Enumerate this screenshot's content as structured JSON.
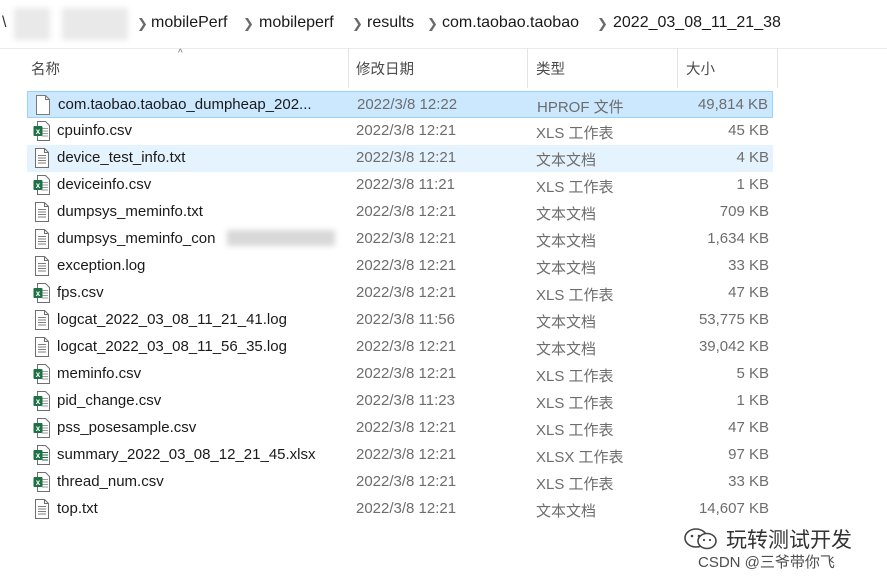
{
  "breadcrumb": [
    "mobilePerf",
    "mobileperf",
    "results",
    "com.taobao.taobao",
    "2022_03_08_11_21_38"
  ],
  "breadcrumb_lead_char": "\\",
  "columns": {
    "name": "名称",
    "date": "修改日期",
    "type": "类型",
    "size": "大小"
  },
  "files": [
    {
      "name": "com.taobao.taobao_dumpheap_202...",
      "date": "2022/3/8 12:22",
      "type": "HPROF 文件",
      "size": "49,814 KB",
      "icon": "blank-file-icon",
      "state": "selected"
    },
    {
      "name": "cpuinfo.csv",
      "date": "2022/3/8 12:21",
      "type": "XLS 工作表",
      "size": "45 KB",
      "icon": "csv-file-icon"
    },
    {
      "name": "device_test_info.txt",
      "date": "2022/3/8 12:21",
      "type": "文本文档",
      "size": "4 KB",
      "icon": "text-file-icon",
      "state": "hover"
    },
    {
      "name": "deviceinfo.csv",
      "date": "2022/3/8 11:21",
      "type": "XLS 工作表",
      "size": "1 KB",
      "icon": "csv-file-icon"
    },
    {
      "name": "dumpsys_meminfo.txt",
      "date": "2022/3/8 12:21",
      "type": "文本文档",
      "size": "709 KB",
      "icon": "text-file-icon"
    },
    {
      "name": "dumpsys_meminfo_con",
      "date": "2022/3/8 12:21",
      "type": "文本文档",
      "size": "1,634 KB",
      "icon": "text-file-icon",
      "blurred": true
    },
    {
      "name": "exception.log",
      "date": "2022/3/8 12:21",
      "type": "文本文档",
      "size": "33 KB",
      "icon": "text-file-icon"
    },
    {
      "name": "fps.csv",
      "date": "2022/3/8 12:21",
      "type": "XLS 工作表",
      "size": "47 KB",
      "icon": "csv-file-icon"
    },
    {
      "name": "logcat_2022_03_08_11_21_41.log",
      "date": "2022/3/8 11:56",
      "type": "文本文档",
      "size": "53,775 KB",
      "icon": "text-file-icon"
    },
    {
      "name": "logcat_2022_03_08_11_56_35.log",
      "date": "2022/3/8 12:21",
      "type": "文本文档",
      "size": "39,042 KB",
      "icon": "text-file-icon"
    },
    {
      "name": "meminfo.csv",
      "date": "2022/3/8 12:21",
      "type": "XLS 工作表",
      "size": "5 KB",
      "icon": "csv-file-icon"
    },
    {
      "name": "pid_change.csv",
      "date": "2022/3/8 11:23",
      "type": "XLS 工作表",
      "size": "1 KB",
      "icon": "csv-file-icon"
    },
    {
      "name": "pss_posesample.csv",
      "date": "2022/3/8 12:21",
      "type": "XLS 工作表",
      "size": "47 KB",
      "icon": "csv-file-icon"
    },
    {
      "name": "summary_2022_03_08_12_21_45.xlsx",
      "date": "2022/3/8 12:21",
      "type": "XLSX 工作表",
      "size": "97 KB",
      "icon": "xlsx-file-icon"
    },
    {
      "name": "thread_num.csv",
      "date": "2022/3/8 12:21",
      "type": "XLS 工作表",
      "size": "33 KB",
      "icon": "csv-file-icon"
    },
    {
      "name": "top.txt",
      "date": "2022/3/8 12:21",
      "type": "文本文档",
      "size": "14,607 KB",
      "icon": "text-file-icon"
    }
  ],
  "watermark": {
    "title": "玩转测试开发",
    "sub": "CSDN @三爷带你飞"
  },
  "colors": {
    "selected_bg": "#cce8ff",
    "selected_border": "#99d1ff",
    "hover_bg": "#e5f3ff",
    "excel_green": "#1e7145"
  }
}
